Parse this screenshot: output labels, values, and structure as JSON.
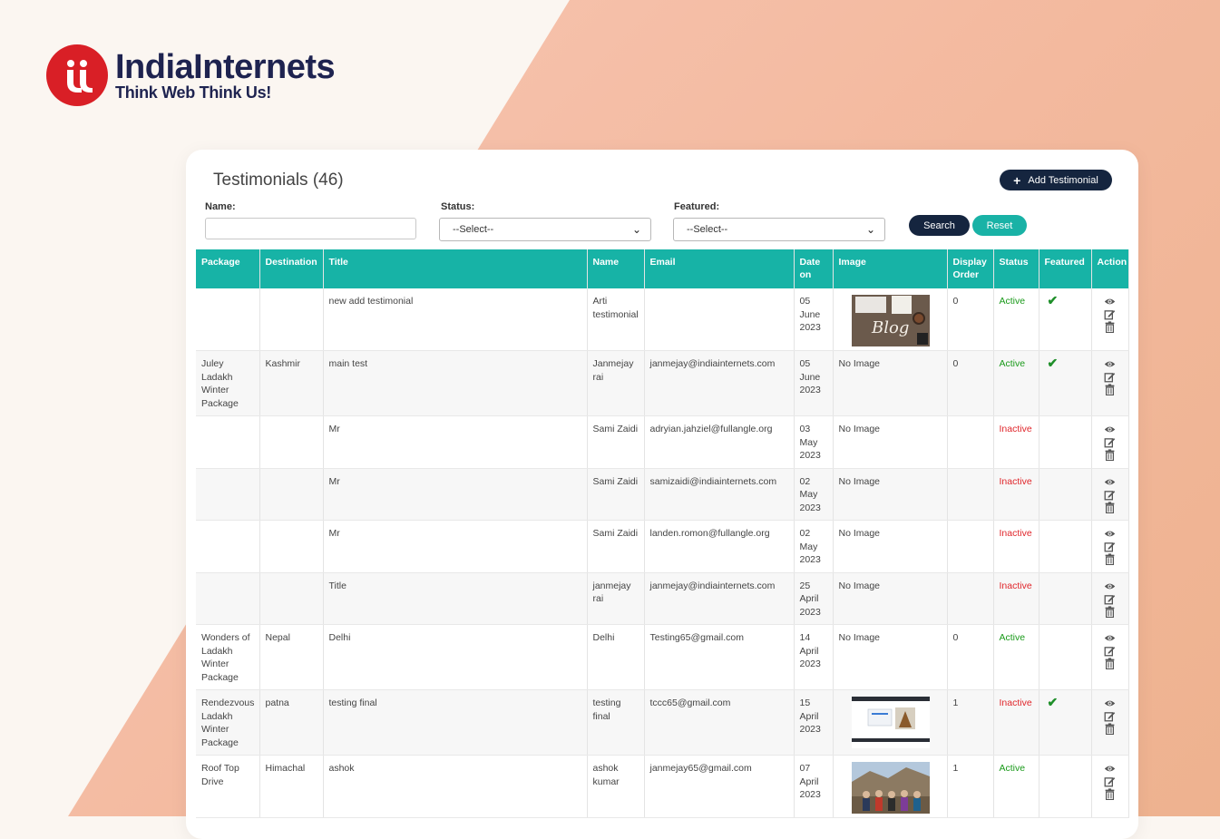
{
  "brand": {
    "name": "IndiaInternets",
    "tagline": "Think Web Think Us!"
  },
  "colors": {
    "header": "#17b3a6",
    "primary_button": "#15253f",
    "reset_button": "#19b2a6",
    "active": "#1a9a1a",
    "inactive": "#e0262b",
    "logo_red": "#d91f26"
  },
  "page": {
    "title": "Testimonials (46)",
    "add_button": "Add Testimonial"
  },
  "filters": {
    "name_label": "Name:",
    "name_value": "",
    "status_label": "Status:",
    "status_value": "--Select--",
    "featured_label": "Featured:",
    "featured_value": "--Select--",
    "search_button": "Search",
    "reset_button": "Reset"
  },
  "table": {
    "columns": [
      "Package",
      "Destination",
      "Title",
      "Name",
      "Email",
      "Date on",
      "Image",
      "Display Order",
      "Status",
      "Featured",
      "Action"
    ],
    "rows": [
      {
        "package": "",
        "destination": "",
        "title": "new add testimonial",
        "name": "Arti testimonial",
        "email": "",
        "date": "05 June 2023",
        "image": "blog-photo",
        "order": "0",
        "status": "Active",
        "featured": true
      },
      {
        "package": "Juley Ladakh Winter Package",
        "destination": "Kashmir",
        "title": "main test",
        "name": "Janmejay rai",
        "email": "janmejay@indiainternets.com",
        "date": "05 June 2023",
        "image": "No Image",
        "order": "0",
        "status": "Active",
        "featured": true
      },
      {
        "package": "",
        "destination": "",
        "title": "Mr",
        "name": "Sami Zaidi",
        "email": "adryian.jahziel@fullangle.org",
        "date": "03 May 2023",
        "image": "No Image",
        "order": "",
        "status": "Inactive",
        "featured": false
      },
      {
        "package": "",
        "destination": "",
        "title": "Mr",
        "name": "Sami Zaidi",
        "email": "samizaidi@indiainternets.com",
        "date": "02 May 2023",
        "image": "No Image",
        "order": "",
        "status": "Inactive",
        "featured": false
      },
      {
        "package": "",
        "destination": "",
        "title": "Mr",
        "name": "Sami Zaidi",
        "email": "landen.romon@fullangle.org",
        "date": "02 May 2023",
        "image": "No Image",
        "order": "",
        "status": "Inactive",
        "featured": false
      },
      {
        "package": "",
        "destination": "",
        "title": "Title",
        "name": "janmejay rai",
        "email": "janmejay@indiainternets.com",
        "date": "25 April 2023",
        "image": "No Image",
        "order": "",
        "status": "Inactive",
        "featured": false
      },
      {
        "package": "Wonders of Ladakh Winter Package",
        "destination": "Nepal",
        "title": "Delhi",
        "name": "Delhi",
        "email": "Testing65@gmail.com",
        "date": "14 April 2023",
        "image": "No Image",
        "order": "0",
        "status": "Active",
        "featured": false
      },
      {
        "package": "Rendezvous Ladakh Winter Package",
        "destination": "patna",
        "title": "testing final",
        "name": "testing final",
        "email": "tccc65@gmail.com",
        "date": "15 April 2023",
        "image": "screenshot-photo",
        "order": "1",
        "status": "Inactive",
        "featured": true
      },
      {
        "package": "Roof Top Drive",
        "destination": "Himachal",
        "title": "ashok",
        "name": "ashok kumar",
        "email": "janmejay65@gmail.com",
        "date": "07 April 2023",
        "image": "group-photo",
        "order": "1",
        "status": "Active",
        "featured": false
      }
    ]
  }
}
